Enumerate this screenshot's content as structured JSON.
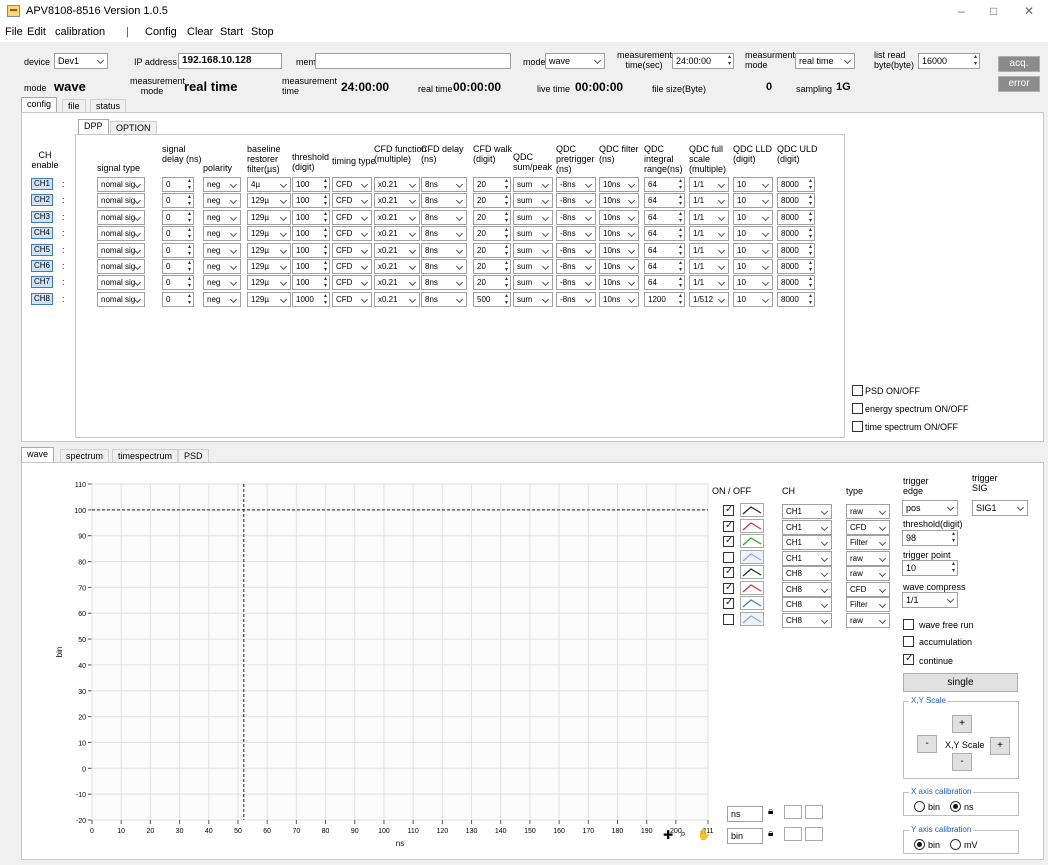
{
  "window": {
    "title": "APV8108-8516  Version 1.0.5"
  },
  "menu": [
    "File",
    "Edit",
    "calibration",
    "|",
    "Config",
    "Clear",
    "Start",
    "Stop"
  ],
  "top": {
    "device_label": "device",
    "device_value": "Dev1",
    "ip_label": "IP address",
    "ip_value": "192.168.10.128",
    "memo_label": "memo",
    "memo_value": "",
    "mode_label": "mode",
    "mode_value": "wave",
    "meas_time_label": "measurement time(sec)",
    "meas_time_value": "24:00:00",
    "meas_mode_label": "measurment mode",
    "meas_mode_value": "real time",
    "list_read_label": "list read byte(byte)",
    "list_read_value": "16000",
    "acq_label": "acq.",
    "error_label": "error"
  },
  "status": {
    "mode_label": "mode",
    "mode_value": "wave",
    "meas_mode_label": "measurement mode",
    "meas_mode_value": "real time",
    "meas_time_label": "measurement time",
    "meas_time_value": "24:00:00",
    "real_time_label": "real time",
    "real_time_value": "00:00:00",
    "live_time_label": "live time",
    "live_time_value": "00:00:00",
    "file_size_label": "file size(Byte)",
    "file_size_value": "0",
    "sampling_label": "sampling",
    "sampling_value": "1G"
  },
  "tabs1": [
    "config",
    "file",
    "status"
  ],
  "tabs2": [
    "DPP",
    "OPTION"
  ],
  "ch_enable_label": "CH enable",
  "columns": [
    "signal type",
    "signal delay (ns)",
    "polarity",
    "baseline restorer filter(µs)",
    "threshold (digit)",
    "timing type",
    "CFD function (multiple)",
    "CFD delay (ns)",
    "CFD walk (digit)",
    "QDC sum/peak",
    "QDC pretrigger (ns)",
    "QDC filter (ns)",
    "QDC integral range(ns)",
    "QDC full scale (multiple)",
    "QDC LLD (digit)",
    "QDC ULD (digit)"
  ],
  "channels": [
    {
      "ch": "CH1",
      "row": [
        "nomal sig",
        "0",
        "neg",
        "4µ",
        "100",
        "CFD",
        "x0.21",
        "8ns",
        "20",
        "sum",
        "-8ns",
        "10ns",
        "64",
        "1/1",
        "10",
        "8000"
      ]
    },
    {
      "ch": "CH2",
      "row": [
        "nomal sig",
        "0",
        "neg",
        "129µ",
        "100",
        "CFD",
        "x0.21",
        "8ns",
        "20",
        "sum",
        "-8ns",
        "10ns",
        "64",
        "1/1",
        "10",
        "8000"
      ]
    },
    {
      "ch": "CH3",
      "row": [
        "nomal sig",
        "0",
        "neg",
        "129µ",
        "100",
        "CFD",
        "x0.21",
        "8ns",
        "20",
        "sum",
        "-8ns",
        "10ns",
        "64",
        "1/1",
        "10",
        "8000"
      ]
    },
    {
      "ch": "CH4",
      "row": [
        "nomal sig",
        "0",
        "neg",
        "129µ",
        "100",
        "CFD",
        "x0.21",
        "8ns",
        "20",
        "sum",
        "-8ns",
        "10ns",
        "64",
        "1/1",
        "10",
        "8000"
      ]
    },
    {
      "ch": "CH5",
      "row": [
        "nomal sig",
        "0",
        "neg",
        "129µ",
        "100",
        "CFD",
        "x0.21",
        "8ns",
        "20",
        "sum",
        "-8ns",
        "10ns",
        "64",
        "1/1",
        "10",
        "8000"
      ]
    },
    {
      "ch": "CH6",
      "row": [
        "nomal sig",
        "0",
        "neg",
        "129µ",
        "100",
        "CFD",
        "x0.21",
        "8ns",
        "20",
        "sum",
        "-8ns",
        "10ns",
        "64",
        "1/1",
        "10",
        "8000"
      ]
    },
    {
      "ch": "CH7",
      "row": [
        "nomal sig",
        "0",
        "neg",
        "129µ",
        "100",
        "CFD",
        "x0.21",
        "8ns",
        "20",
        "sum",
        "-8ns",
        "10ns",
        "64",
        "1/1",
        "10",
        "8000"
      ]
    },
    {
      "ch": "CH8",
      "row": [
        "nomal sig",
        "0",
        "neg",
        "129µ",
        "1000",
        "CFD",
        "x0.21",
        "8ns",
        "500",
        "sum",
        "-8ns",
        "10ns",
        "1200",
        "1/512",
        "10",
        "8000"
      ]
    }
  ],
  "options": [
    "PSD ON/OFF",
    "energy spectrum ON/OFF",
    "time spectrum ON/OFF"
  ],
  "tabs3": [
    "wave",
    "spectrum",
    "timespectrum",
    "PSD"
  ],
  "chart_data": {
    "type": "line",
    "xlabel": "ns",
    "ylabel": "bin",
    "xlim": [
      0,
      211
    ],
    "ylim": [
      -20,
      110
    ],
    "xticks": [
      0,
      10,
      20,
      30,
      40,
      50,
      60,
      70,
      80,
      90,
      100,
      110,
      120,
      130,
      140,
      150,
      160,
      170,
      180,
      190,
      200,
      211
    ],
    "yticks": [
      110,
      100,
      90,
      80,
      70,
      60,
      50,
      40,
      30,
      20,
      10,
      0,
      -10,
      -20
    ],
    "cursor_x": 52,
    "cursor_y": 100,
    "grid": true
  },
  "traces": {
    "headers": [
      "ON / OFF",
      "CH",
      "type"
    ],
    "rows": [
      {
        "on": true,
        "color": "#222222",
        "ch": "CH1",
        "type": "raw"
      },
      {
        "on": true,
        "color": "#e03030",
        "ch": "CH1",
        "type": "CFD"
      },
      {
        "on": true,
        "color": "#2aa02a",
        "ch": "CH1",
        "type": "Filter"
      },
      {
        "on": false,
        "color": "#8aa8e0",
        "ch": "CH1",
        "type": "raw"
      },
      {
        "on": true,
        "color": "#222222",
        "ch": "CH8",
        "type": "raw"
      },
      {
        "on": true,
        "color": "#e03030",
        "ch": "CH8",
        "type": "CFD"
      },
      {
        "on": true,
        "color": "#3a7ad0",
        "ch": "CH8",
        "type": "Filter"
      },
      {
        "on": false,
        "color": "#8aa8e0",
        "ch": "CH8",
        "type": "raw"
      }
    ]
  },
  "trigger": {
    "edge_label": "trigger edge",
    "edge_value": "pos",
    "sig_label": "trigger SIG",
    "sig_value": "SIG1",
    "threshold_label": "threshold(digit)",
    "threshold_value": "98",
    "point_label": "trigger point",
    "point_value": "10",
    "compress_label": "wave compress",
    "compress_value": "1/1",
    "free_run": "wave free run",
    "accumulation": "accumulation",
    "continue": "continue",
    "single": "single"
  },
  "scale": {
    "title": "X,Y Scale",
    "plus": "+",
    "minus": "-",
    "center": "X,Y Scale"
  },
  "xcal": {
    "title": "X axis calibration",
    "opt1": "bin",
    "opt2": "ns"
  },
  "ycal": {
    "title": "Y axis calibration",
    "opt1": "bin",
    "opt2": "mV"
  },
  "axis_units": {
    "x": "ns",
    "y": "bin"
  }
}
